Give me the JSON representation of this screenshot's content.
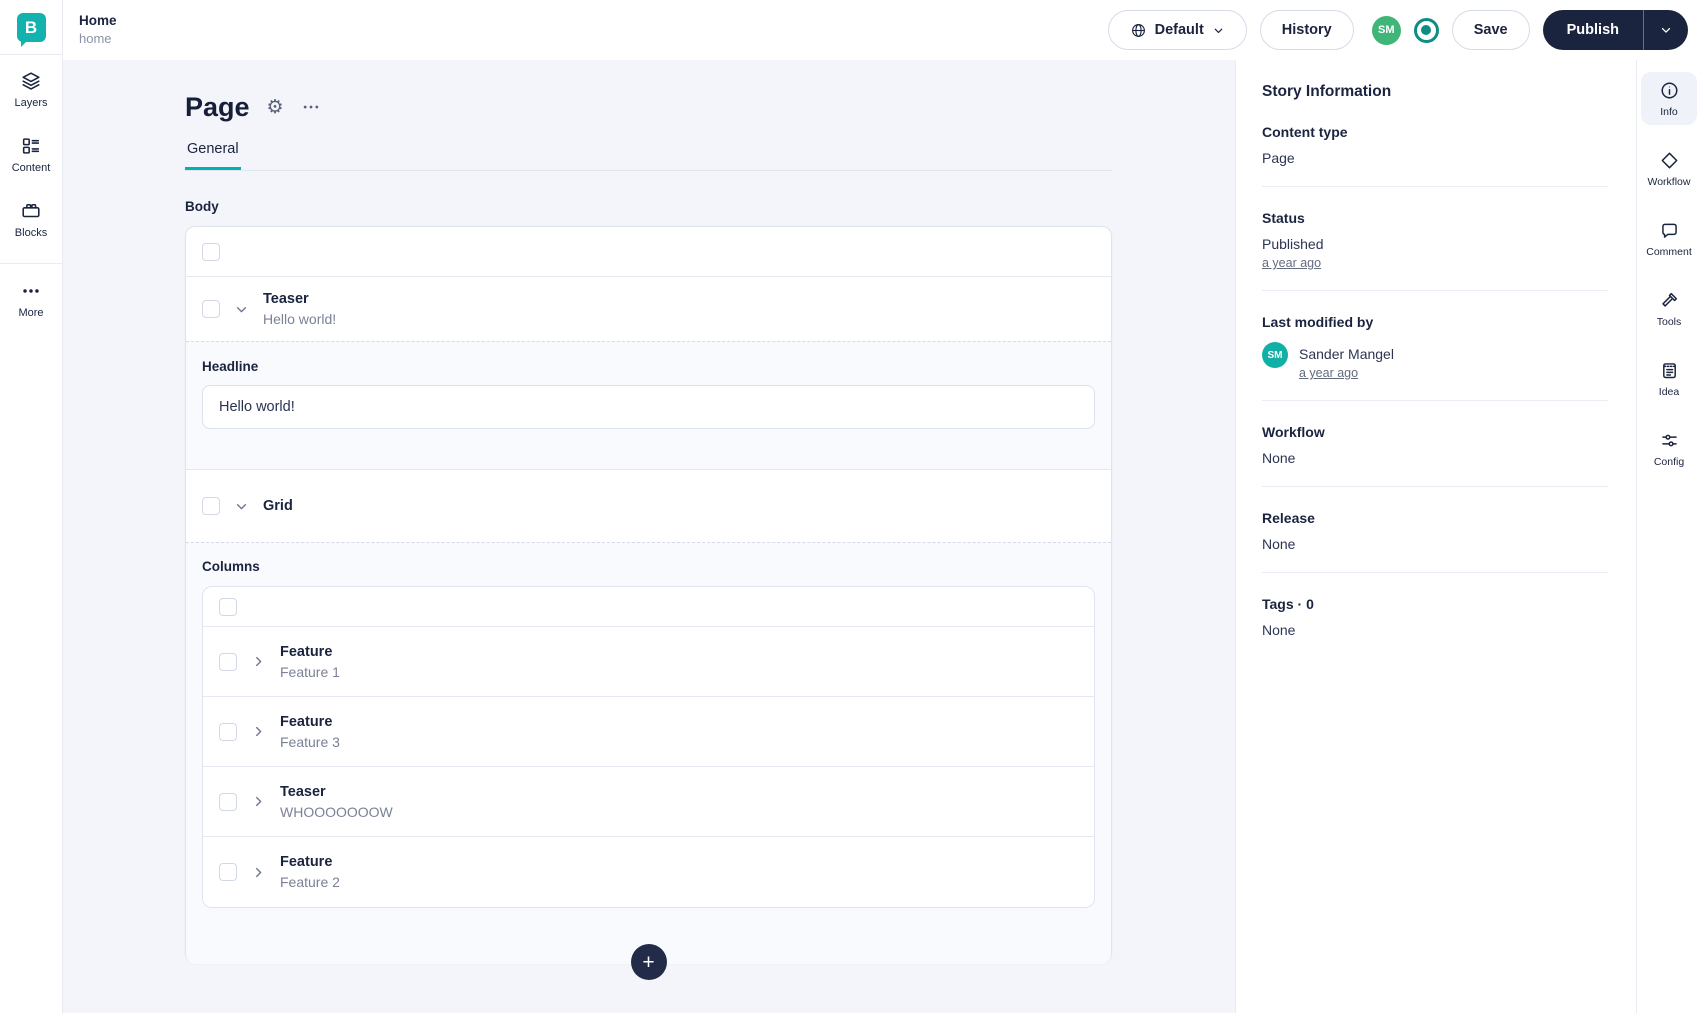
{
  "header": {
    "story_title": "Home",
    "story_slug": "home",
    "language_label": "Default",
    "history_label": "History",
    "user_initials": "SM",
    "save_label": "Save",
    "publish_label": "Publish"
  },
  "left_nav": {
    "items": [
      {
        "label": "Layers",
        "icon": "layers-icon"
      },
      {
        "label": "Content",
        "icon": "content-icon"
      },
      {
        "label": "Blocks",
        "icon": "blocks-icon"
      },
      {
        "label": "More",
        "icon": "more-icon"
      }
    ]
  },
  "editor": {
    "title": "Page",
    "tab": "General",
    "body_label": "Body",
    "teaser_block": {
      "type": "Teaser",
      "preview": "Hello world!"
    },
    "headline_field": {
      "label": "Headline",
      "value": "Hello world!"
    },
    "grid_block": {
      "type": "Grid"
    },
    "columns_label": "Columns",
    "column_items": [
      {
        "type": "Feature",
        "name": "Feature 1"
      },
      {
        "type": "Feature",
        "name": "Feature 3"
      },
      {
        "type": "Teaser",
        "name": "WHOOOOOOOW"
      },
      {
        "type": "Feature",
        "name": "Feature 2"
      }
    ]
  },
  "story_info": {
    "title": "Story Information",
    "content_type_label": "Content type",
    "content_type_value": "Page",
    "status_label": "Status",
    "status_value": "Published",
    "status_time": "a year ago",
    "modified_label": "Last modified by",
    "modified_initials": "SM",
    "modified_user": "Sander Mangel",
    "modified_time": "a year ago",
    "workflow_label": "Workflow",
    "workflow_value": "None",
    "release_label": "Release",
    "release_value": "None",
    "tags_label": "Tags · 0",
    "tags_value": "None"
  },
  "right_nav": {
    "items": [
      {
        "label": "Info",
        "icon": "info-icon",
        "active": true
      },
      {
        "label": "Workflow",
        "icon": "workflow-icon",
        "active": false
      },
      {
        "label": "Comment",
        "icon": "comment-icon",
        "active": false
      },
      {
        "label": "Tools",
        "icon": "tools-icon",
        "active": false
      },
      {
        "label": "Idea",
        "icon": "idea-icon",
        "active": false
      },
      {
        "label": "Config",
        "icon": "config-icon",
        "active": false
      }
    ]
  },
  "icons": {
    "gear": "⚙",
    "plus": "+",
    "logo_letter": "B"
  },
  "colors": {
    "brand_teal": "#00b3b0",
    "ink": "#1b243f",
    "avatar_green": "#3fb577",
    "avatar_teal": "#12b0a4",
    "muted_text": "#7a8296",
    "canvas": "#f4f5fa"
  }
}
